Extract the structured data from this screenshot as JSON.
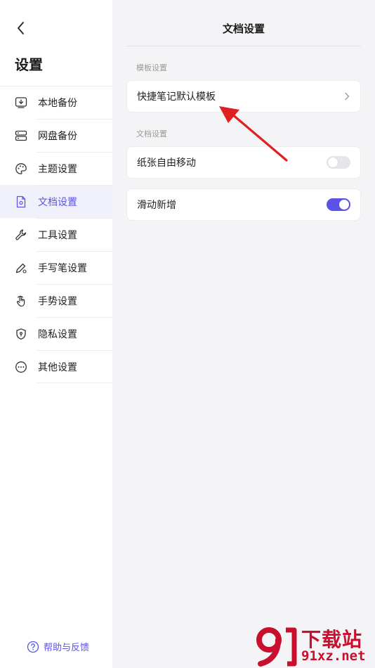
{
  "sidebar": {
    "title": "设置",
    "items": [
      {
        "label": "本地备份",
        "icon": "local-backup-icon"
      },
      {
        "label": "网盘备份",
        "icon": "cloud-drive-icon"
      },
      {
        "label": "主题设置",
        "icon": "palette-icon"
      },
      {
        "label": "文档设置",
        "icon": "document-settings-icon",
        "active": true
      },
      {
        "label": "工具设置",
        "icon": "wrench-icon"
      },
      {
        "label": "手写笔设置",
        "icon": "pen-icon"
      },
      {
        "label": "手势设置",
        "icon": "hand-gesture-icon"
      },
      {
        "label": "隐私设置",
        "icon": "shield-icon"
      },
      {
        "label": "其他设置",
        "icon": "more-icon"
      }
    ],
    "help_label": "帮助与反馈"
  },
  "main": {
    "title": "文档设置",
    "template_section": "模板设置",
    "template_item": "快捷笔记默认模板",
    "document_section": "文档设置",
    "paper_move_label": "纸张自由移动",
    "paper_move_on": false,
    "slide_add_label": "滑动新增",
    "slide_add_on": true
  },
  "colors": {
    "accent": "#5b53e6",
    "arrow": "#e02020",
    "watermark": "#c8102e"
  },
  "watermark": {
    "cn": "下载站",
    "en": "91xz.net"
  }
}
